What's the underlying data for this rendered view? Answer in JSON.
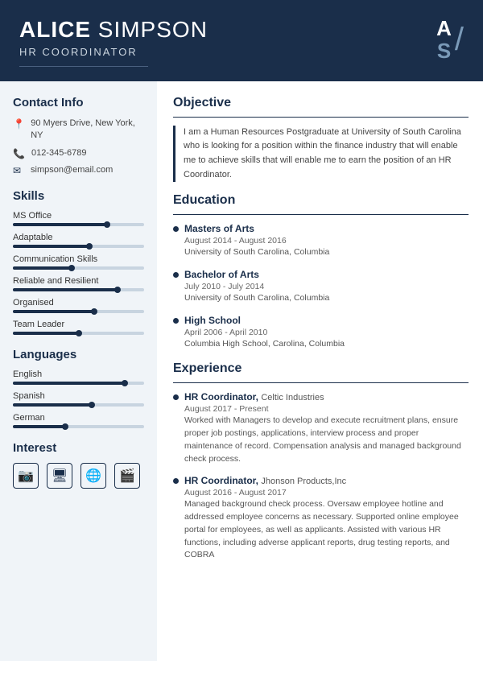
{
  "header": {
    "first_name": "ALICE",
    "last_name": "SIMPSON",
    "title": "HR COORDINATOR",
    "monogram_a": "A",
    "monogram_s": "S"
  },
  "sidebar": {
    "contact_section": "Contact Info",
    "address": "90 Myers Drive, New York, NY",
    "phone": "012-345-6789",
    "email": "simpson@email.com",
    "skills_section": "Skills",
    "skills": [
      {
        "label": "MS Office",
        "fill": 72,
        "dot": 72
      },
      {
        "label": "Adaptable",
        "fill": 58,
        "dot": 58
      },
      {
        "label": "Communication Skills",
        "fill": 45,
        "dot": 45
      },
      {
        "label": "Reliable and Resilient",
        "fill": 80,
        "dot": 80
      },
      {
        "label": "Organised",
        "fill": 62,
        "dot": 62
      },
      {
        "label": "Team Leader",
        "fill": 50,
        "dot": 50
      }
    ],
    "languages_section": "Languages",
    "languages": [
      {
        "label": "English",
        "fill": 85,
        "dot": 85
      },
      {
        "label": "Spanish",
        "fill": 60,
        "dot": 60
      },
      {
        "label": "German",
        "fill": 40,
        "dot": 40
      }
    ],
    "interest_section": "Interest",
    "interests": [
      {
        "icon": "📷",
        "name": "camera"
      },
      {
        "icon": "🖥",
        "name": "computer"
      },
      {
        "icon": "🌐",
        "name": "globe"
      },
      {
        "icon": "🎬",
        "name": "video"
      }
    ]
  },
  "content": {
    "objective_section": "Objective",
    "objective_text": "I am a Human Resources Postgraduate at University of South Carolina who is looking for a position within the finance industry that will enable me to achieve skills that will enable me to earn the position of an HR Coordinator.",
    "education_section": "Education",
    "education": [
      {
        "degree": "Masters of Arts",
        "dates": "August 2014 - August 2016",
        "school": "University of South Carolina, Columbia"
      },
      {
        "degree": "Bachelor of Arts",
        "dates": "July 2010 - July 2014",
        "school": "University of South Carolina, Columbia"
      },
      {
        "degree": "High School",
        "dates": "April 2006 - April 2010",
        "school": "Columbia High School, Carolina, Columbia"
      }
    ],
    "experience_section": "Experience",
    "experience": [
      {
        "title": "HR Coordinator",
        "company": "Celtic Industries",
        "dates": "August 2017 - Present",
        "desc": "Worked with Managers to develop and execute recruitment plans, ensure proper job postings, applications, interview process and proper maintenance of record. Compensation analysis and managed background check process."
      },
      {
        "title": "HR Coordinator",
        "company": "Jhonson Products,Inc",
        "dates": "August 2016 - August 2017",
        "desc": "Managed background check process. Oversaw employee hotline and addressed employee concerns as necessary. Supported online employee portal for employees, as well as applicants. Assisted with various HR functions, including adverse applicant reports, drug testing reports, and COBRA"
      }
    ]
  }
}
